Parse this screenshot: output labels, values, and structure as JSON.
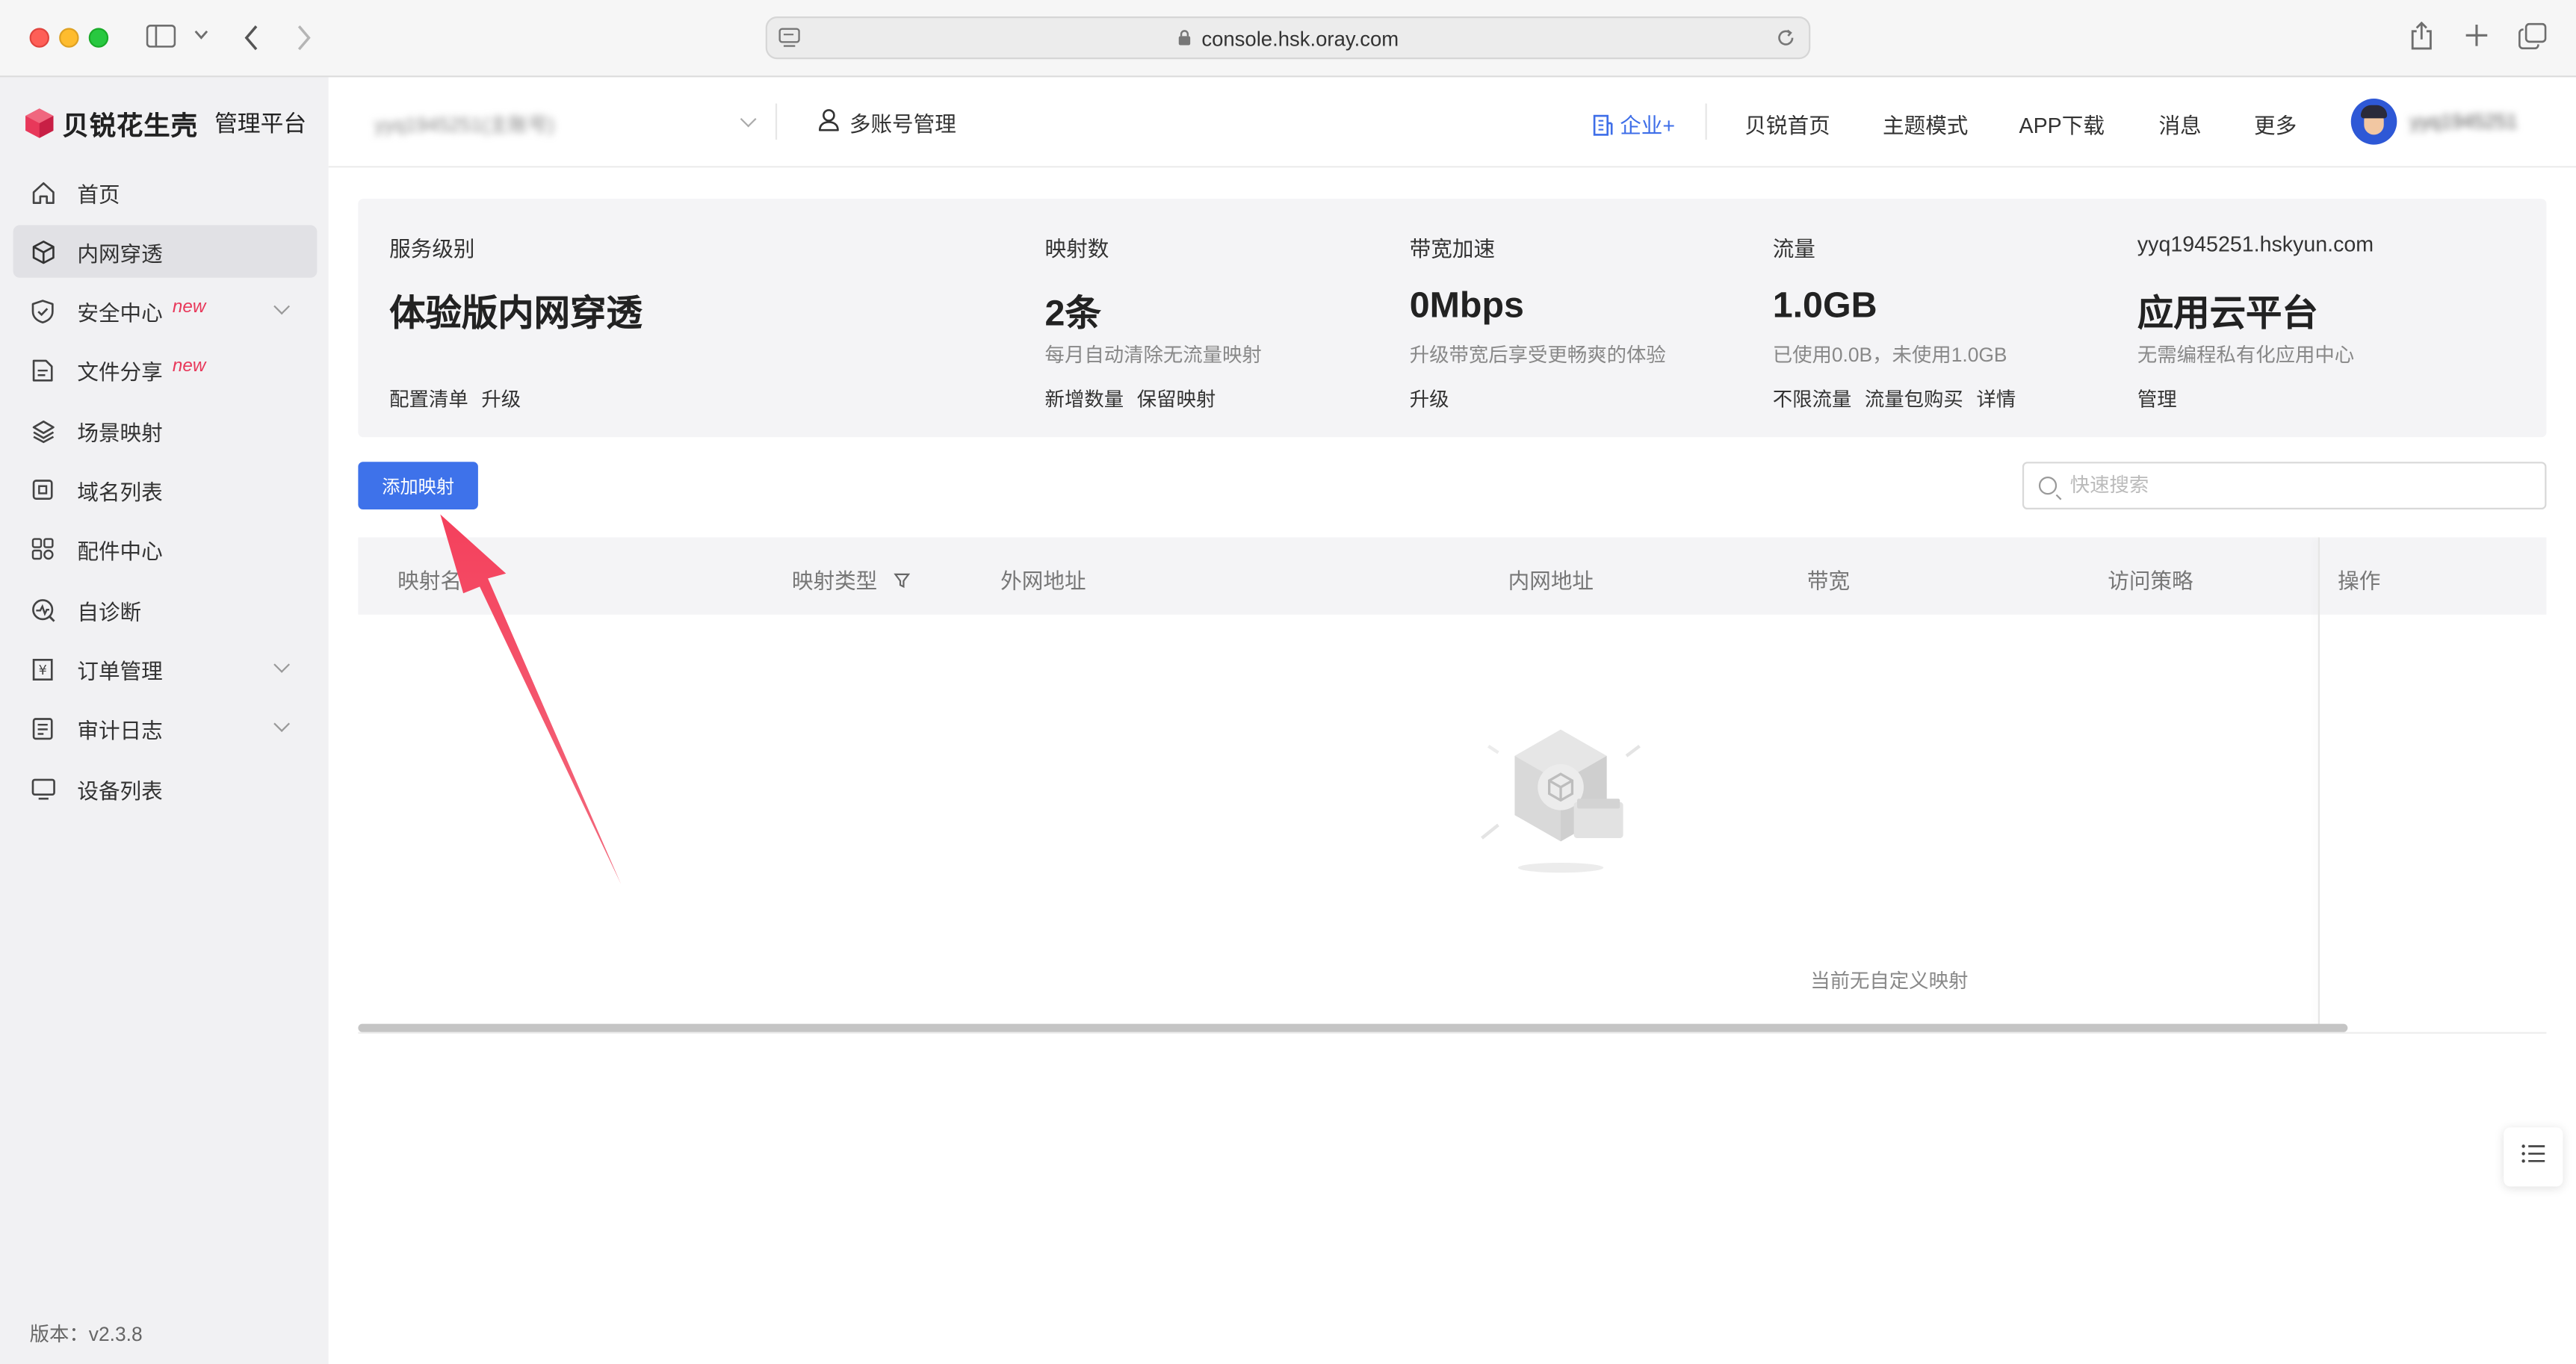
{
  "browser": {
    "url": "console.hsk.oray.com"
  },
  "brand": {
    "name": "贝锐花生壳",
    "subtitle": "管理平台"
  },
  "sidebar": {
    "items": [
      {
        "label": "首页",
        "icon": "home-icon"
      },
      {
        "label": "内网穿透",
        "icon": "cube-icon",
        "active": true
      },
      {
        "label": "安全中心",
        "icon": "shield-icon",
        "badge": "new",
        "expandable": true
      },
      {
        "label": "文件分享",
        "icon": "file-share-icon",
        "badge": "new"
      },
      {
        "label": "场景映射",
        "icon": "scene-icon"
      },
      {
        "label": "域名列表",
        "icon": "domain-icon"
      },
      {
        "label": "配件中心",
        "icon": "grid-icon"
      },
      {
        "label": "自诊断",
        "icon": "diagnose-icon"
      },
      {
        "label": "订单管理",
        "icon": "order-icon",
        "expandable": true
      },
      {
        "label": "审计日志",
        "icon": "audit-log-icon",
        "expandable": true
      },
      {
        "label": "设备列表",
        "icon": "device-icon"
      }
    ],
    "version": "版本：v2.3.8"
  },
  "header": {
    "account_select": "yyq1945251(主账号)",
    "multi_account": "多账号管理",
    "links": [
      "企业+",
      "贝锐首页",
      "主题模式",
      "APP下载",
      "消息",
      "更多"
    ],
    "user_name": "yyq1945251"
  },
  "stats": {
    "service": {
      "label": "服务级别",
      "value": "体验版内网穿透",
      "actions": [
        "配置清单",
        "升级"
      ]
    },
    "mappings": {
      "label": "映射数",
      "value": "2条",
      "desc": "每月自动清除无流量映射",
      "actions": [
        "新增数量",
        "保留映射"
      ]
    },
    "bandwidth": {
      "label": "带宽加速",
      "value": "0Mbps",
      "desc": "升级带宽后享受更畅爽的体验",
      "actions": [
        "升级"
      ]
    },
    "traffic": {
      "label": "流量",
      "value": "1.0GB",
      "desc": "已使用0.0B，未使用1.0GB",
      "actions": [
        "不限流量",
        "流量包购买",
        "详情"
      ]
    },
    "cloud": {
      "label": "yyq1945251.hskyun.com",
      "value": "应用云平台",
      "desc": "无需编程私有化应用中心",
      "actions": [
        "管理"
      ]
    }
  },
  "toolbar": {
    "add_label": "添加映射",
    "search_placeholder": "快速搜索"
  },
  "table": {
    "columns": [
      "映射名",
      "映射类型",
      "外网地址",
      "内网地址",
      "带宽",
      "访问策略",
      "操作"
    ],
    "empty_text": "当前无自定义映射"
  },
  "colors": {
    "primary": "#3e72ea",
    "badge_new": "#e8385a",
    "annotation_arrow": "#f2415e"
  }
}
